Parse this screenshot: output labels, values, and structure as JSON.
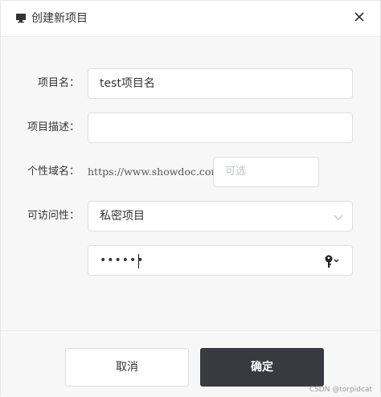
{
  "dialog": {
    "title": "创建新项目",
    "header_icon": "monitor-icon",
    "close_icon": "close-icon"
  },
  "form": {
    "project_name": {
      "label": "项目名：",
      "value": "test项目名"
    },
    "project_description": {
      "label": "项目描述：",
      "value": ""
    },
    "custom_domain": {
      "label": "个性域名：",
      "prefix": "https://www.showdoc.com.cn/",
      "placeholder": "可选",
      "value": ""
    },
    "visibility": {
      "label": "可访问性：",
      "selected": "私密项目",
      "chevron_icon": "chevron-down-icon"
    },
    "password": {
      "masked_value": "••••••",
      "key_icon": "key-icon"
    }
  },
  "footer": {
    "cancel_label": "取消",
    "confirm_label": "确定"
  },
  "watermark": "CSDN @torpidcat",
  "colors": {
    "confirm_bg": "#373b40",
    "dialog_bg": "#f7f7f8",
    "border": "#dcdfe6",
    "placeholder": "#c0c4cc"
  }
}
